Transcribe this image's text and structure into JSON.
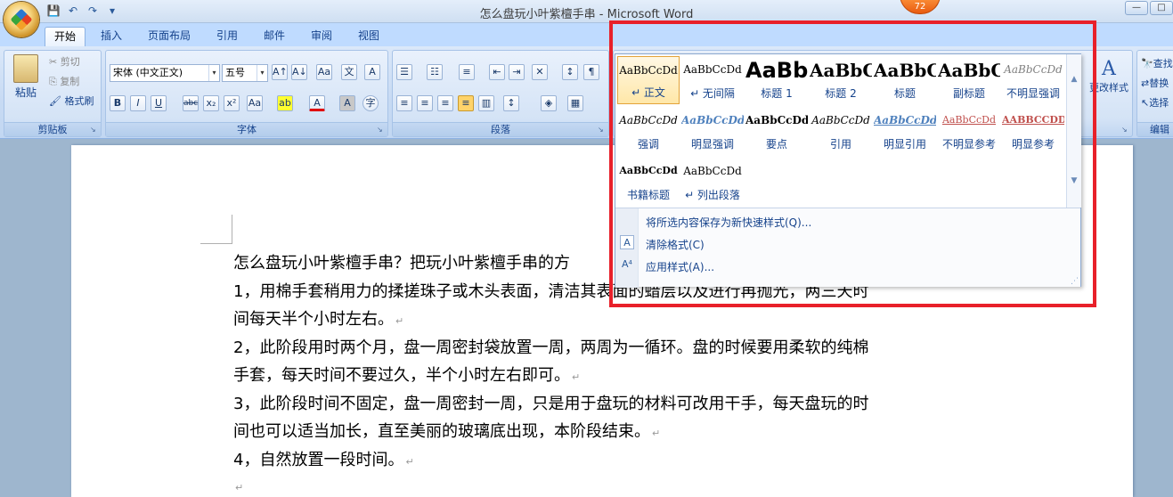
{
  "window": {
    "title": "怎么盘玩小叶紫檀手串 - Microsoft Word",
    "badge": "72",
    "controls": [
      "—",
      "□"
    ]
  },
  "qat": {
    "save": "💾",
    "undo": "↶",
    "redo": "↷",
    "more": "▾"
  },
  "tabs": [
    "开始",
    "插入",
    "页面布局",
    "引用",
    "邮件",
    "审阅",
    "视图"
  ],
  "ribbon": {
    "clipboard": {
      "paste": "粘贴",
      "cut": "剪切",
      "copy": "复制",
      "format_painter": "格式刷",
      "label": "剪贴板"
    },
    "font": {
      "font_name": "宋体 (中文正文)",
      "font_size": "五号",
      "label": "字体"
    },
    "paragraph": {
      "label": "段落"
    },
    "styles": {
      "change_styles": "更改样式"
    },
    "editing": {
      "find": "查找",
      "replace": "替换",
      "select": "选择",
      "label": "编辑"
    }
  },
  "styles_gallery": {
    "items": [
      {
        "sample": "AaBbCcDd",
        "name": "↵ 正文",
        "selected": true
      },
      {
        "sample": "AaBbCcDd",
        "name": "↵ 无间隔"
      },
      {
        "sample": "AaBb",
        "name": "标题 1"
      },
      {
        "sample": "AaBbC",
        "name": "标题 2"
      },
      {
        "sample": "AaBbC",
        "name": "标题"
      },
      {
        "sample": "AaBbC",
        "name": "副标题"
      },
      {
        "sample": "AaBbCcDd",
        "name": "不明显强调"
      },
      {
        "sample": "AaBbCcDd",
        "name": "强调"
      },
      {
        "sample": "AaBbCcDd",
        "name": "明显强调"
      },
      {
        "sample": "AaBbCcDd",
        "name": "要点"
      },
      {
        "sample": "AaBbCcDd",
        "name": "引用"
      },
      {
        "sample": "AaBbCcDd",
        "name": "明显引用"
      },
      {
        "sample": "AaBbCcDd",
        "name": "不明显参考"
      },
      {
        "sample": "AABBCCDD",
        "name": "明显参考"
      },
      {
        "sample": "AaBbCcDd",
        "name": "书籍标题"
      },
      {
        "sample": "AaBbCcDd",
        "name": "↵ 列出段落"
      }
    ],
    "menu": [
      "将所选内容保存为新快速样式(Q)...",
      "清除格式(C)",
      "应用样式(A)..."
    ],
    "highlight_color": "#e8202a"
  },
  "document": {
    "lines": [
      "怎么盘玩小叶紫檀手串？把玩小叶紫檀手串的方",
      "1，用棉手套稍用力的揉搓珠子或木头表面，清洁其表面的蜡层以及进行再抛光，两三天时",
      "间每天半个小时左右。",
      "2，此阶段用时两个月，盘一周密封袋放置一周，两周为一循环。盘的时候要用柔软的纯棉",
      "手套，每天时间不要过久，半个小时左右即可。",
      "3，此阶段时间不固定，盘一周密封一周，只是用于盘玩的材料可改用干手，每天盘玩的时",
      "间也可以适当加长，直至美丽的玻璃底出现，本阶段结束。",
      "4，自然放置一段时间。",
      ""
    ],
    "paragraph_mark": "↵"
  }
}
